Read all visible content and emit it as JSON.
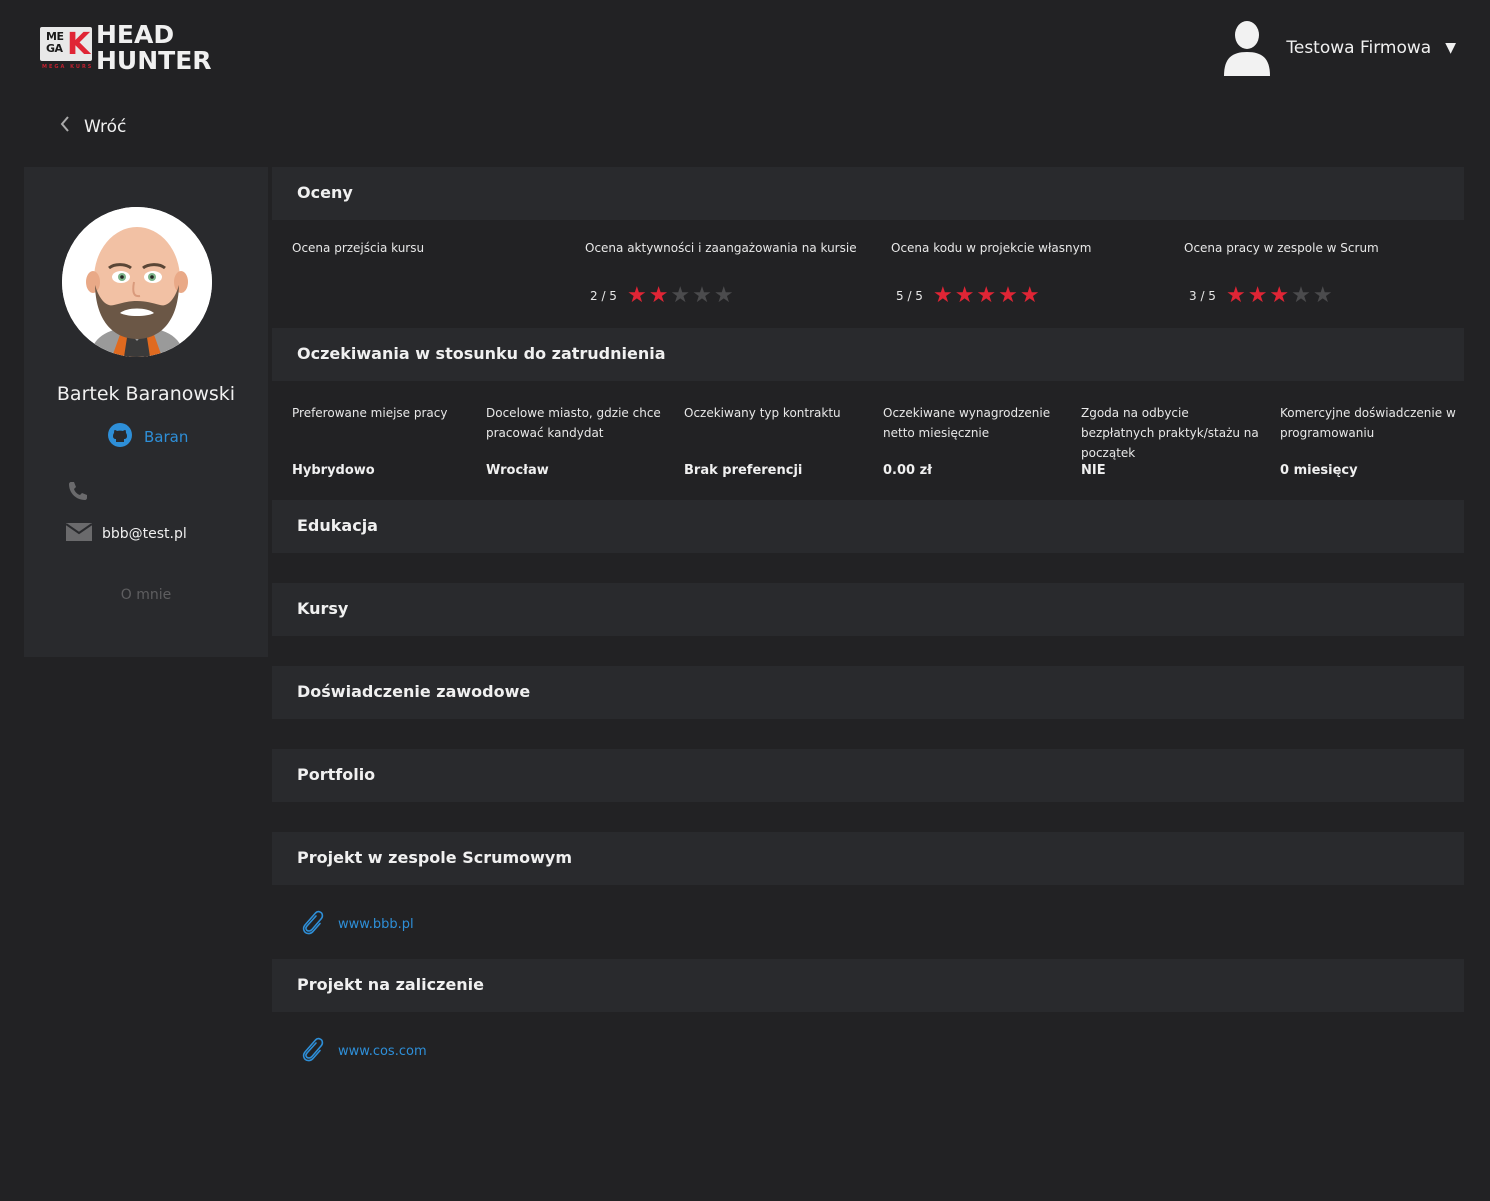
{
  "header": {
    "logo_badge_top": "ME",
    "logo_badge_bottom": "GA",
    "logo_badge_letter": "K",
    "logo_subtext": "MEGA KURS",
    "logo_line1": "HEAD",
    "logo_line2": "HUNTER",
    "user_name": "Testowa Firmowa",
    "menu_caret": "▼",
    "avatar_icon": "user-silhouette-icon"
  },
  "back": {
    "label": "Wróć",
    "icon": "chevron-left-icon"
  },
  "candidate": {
    "name": "Bartek Baranowski",
    "github_label": "Baran",
    "phone": "",
    "email": "bbb@test.pl",
    "about_label": "O mnie"
  },
  "sections": {
    "ratings": "Oceny",
    "expectations": "Oczekiwania w stosunku do zatrudnienia",
    "education": "Edukacja",
    "courses": "Kursy",
    "experience": "Doświadczenie zawodowe",
    "portfolio": "Portfolio",
    "scrum_project": "Projekt w zespole Scrumowym",
    "final_project": "Projekt na zaliczenie"
  },
  "ratings": [
    {
      "label": "Ocena przejścia kursu",
      "score_text": "",
      "value": null,
      "max": 5
    },
    {
      "label": "Ocena aktywności i zaangażowania na kursie",
      "score_text": "2 / 5",
      "value": 2,
      "max": 5
    },
    {
      "label": "Ocena kodu w projekcie własnym",
      "score_text": "5 / 5",
      "value": 5,
      "max": 5
    },
    {
      "label": "Ocena pracy w zespole w Scrum",
      "score_text": "3 / 5",
      "value": 3,
      "max": 5
    }
  ],
  "expectations": [
    {
      "label": "Preferowane miejse pracy",
      "value": "Hybrydowo"
    },
    {
      "label": "Docelowe miasto, gdzie chce pracować kandydat",
      "value": "Wrocław"
    },
    {
      "label": "Oczekiwany typ kontraktu",
      "value": "Brak preferencji"
    },
    {
      "label": "Oczekiwane wynagrodzenie netto miesięcznie",
      "value": "0.00 zł"
    },
    {
      "label": "Zgoda na odbycie bezpłatnych praktyk/stażu na początek",
      "value": "NIE"
    },
    {
      "label": "Komercyjne doświadczenie w programowaniu",
      "value": "0 miesięcy"
    }
  ],
  "links": {
    "scrum_project_url": "www.bbb.pl",
    "final_project_url": "www.cos.com",
    "link_icon": "paperclip-icon"
  },
  "colors": {
    "background": "#222224",
    "panel": "#292a2d",
    "accent_red": "#e02535",
    "link_blue": "#2e8fd8",
    "star_off": "#4b4b4d"
  }
}
